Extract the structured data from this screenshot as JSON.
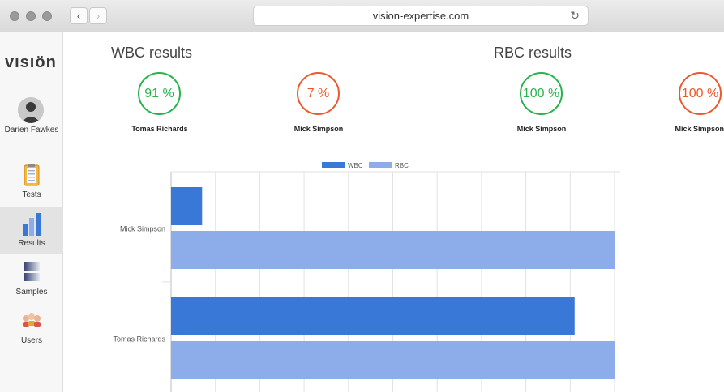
{
  "browser": {
    "url": "vision-expertise.com",
    "back_label": "‹",
    "forward_label": "›",
    "reload_label": "↻"
  },
  "sidebar": {
    "logo": "vısıön",
    "user_name": "Darien Fawkes",
    "items": [
      {
        "label": "Tests",
        "icon": "clipboard-icon"
      },
      {
        "label": "Results",
        "icon": "bar-chart-icon",
        "active": true
      },
      {
        "label": "Samples",
        "icon": "samples-icon"
      },
      {
        "label": "Users",
        "icon": "users-icon"
      }
    ]
  },
  "wbc": {
    "title": "WBC results",
    "gauges": [
      {
        "value": "91 %",
        "name": "Tomas Richards",
        "status": "good"
      },
      {
        "value": "7 %",
        "name": "Mick Simpson",
        "status": "bad"
      }
    ]
  },
  "rbc": {
    "title": "RBC results",
    "gauges": [
      {
        "value": "100 %",
        "name": "Mick Simpson",
        "status": "good"
      },
      {
        "value": "100 %",
        "name": "Mick Simpson",
        "status": "bad"
      }
    ]
  },
  "colors": {
    "good": "#27b34b",
    "bad": "#ea5a2b",
    "wbc": "#3a78d8",
    "rbc": "#8cacea"
  },
  "chart_data": {
    "type": "bar",
    "orientation": "horizontal",
    "categories": [
      "Mick Simpson",
      "Tomas Richards"
    ],
    "series": [
      {
        "name": "WBC",
        "values": [
          7,
          91
        ],
        "color": "#3a78d8"
      },
      {
        "name": "RBC",
        "values": [
          100,
          100
        ],
        "color": "#8cacea"
      }
    ],
    "xlim": [
      0,
      100
    ],
    "grid": true,
    "legend": "top-center"
  }
}
